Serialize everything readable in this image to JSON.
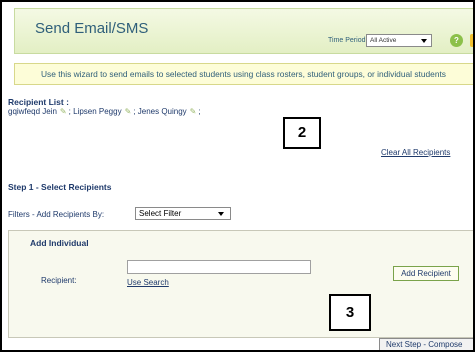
{
  "header": {
    "title": "Send Email/SMS",
    "time_period_label": "Time Period:",
    "time_period_value": "All Active",
    "help_icon_glyph": "?"
  },
  "banner": {
    "text": "Use this wizard to send emails to selected students using class rosters, student groups, or individual students"
  },
  "recipients": {
    "label": "Recipient List :",
    "items": [
      {
        "name": "gqiwfeqd Jein",
        "sep": ";"
      },
      {
        "name": "Lipsen Peggy",
        "sep": ";"
      },
      {
        "name": "Jenes Quingy",
        "sep": ";"
      }
    ],
    "clear_all": "Clear All Recipients"
  },
  "callouts": {
    "first": "2",
    "second": "3"
  },
  "step1": {
    "title": "Step 1 - Select Recipients",
    "filters_label": "Filters - Add Recipients By:",
    "filter_value": "Select Filter"
  },
  "add_individual": {
    "title": "Add Individual",
    "recipient_label": "Recipient:",
    "recipient_value": "",
    "use_search": "Use Search",
    "add_button": "Add Recipient"
  },
  "footer": {
    "next_button": "Next Step - Compose"
  },
  "colors": {
    "accent_green": "#8cc04a",
    "link_blue": "#1f3a6b",
    "header_title": "#2f5f7a"
  }
}
